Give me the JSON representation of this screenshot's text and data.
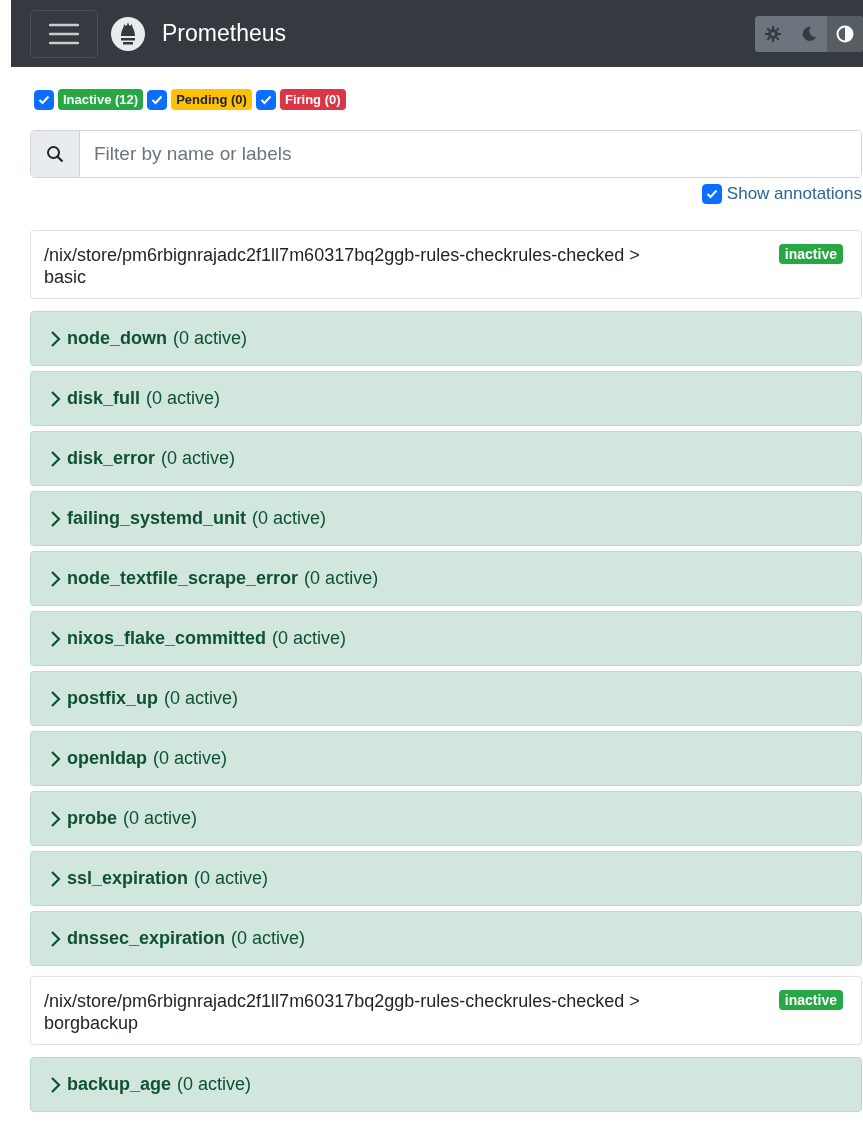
{
  "navbar": {
    "title": "Prometheus",
    "theme_buttons": [
      {
        "kind": "light",
        "selected": false
      },
      {
        "kind": "dark",
        "selected": false
      },
      {
        "kind": "auto",
        "selected": true
      }
    ]
  },
  "filters": [
    {
      "label": "Inactive (12)",
      "checked": true,
      "color": "#28a745"
    },
    {
      "label": "Pending (0)",
      "checked": true,
      "color": "#ffc107"
    },
    {
      "label": "Firing (0)",
      "checked": true,
      "color": "#dc3545"
    }
  ],
  "search": {
    "placeholder": "Filter by name or labels"
  },
  "show_annotations": {
    "label": "Show annotations",
    "checked": true
  },
  "groups": [
    {
      "title": "/nix/store/pm6rbignrajadc2f1ll7m60317bq2ggb-rules-checkrules-checked >\nbasic",
      "state": "inactive",
      "rules": [
        {
          "name": "node_down",
          "count": "(0 active)"
        },
        {
          "name": "disk_full",
          "count": "(0 active)"
        },
        {
          "name": "disk_error",
          "count": "(0 active)"
        },
        {
          "name": "failing_systemd_unit",
          "count": "(0 active)"
        },
        {
          "name": "node_textfile_scrape_error",
          "count": "(0 active)"
        },
        {
          "name": "nixos_flake_committed",
          "count": "(0 active)"
        },
        {
          "name": "postfix_up",
          "count": "(0 active)"
        },
        {
          "name": "openldap",
          "count": "(0 active)"
        },
        {
          "name": "probe",
          "count": "(0 active)"
        },
        {
          "name": "ssl_expiration",
          "count": "(0 active)"
        },
        {
          "name": "dnssec_expiration",
          "count": "(0 active)"
        }
      ]
    },
    {
      "title": "/nix/store/pm6rbignrajadc2f1ll7m60317bq2ggb-rules-checkrules-checked >\nborgbackup",
      "state": "inactive",
      "rules": [
        {
          "name": "backup_age",
          "count": "(0 active)"
        }
      ]
    }
  ]
}
